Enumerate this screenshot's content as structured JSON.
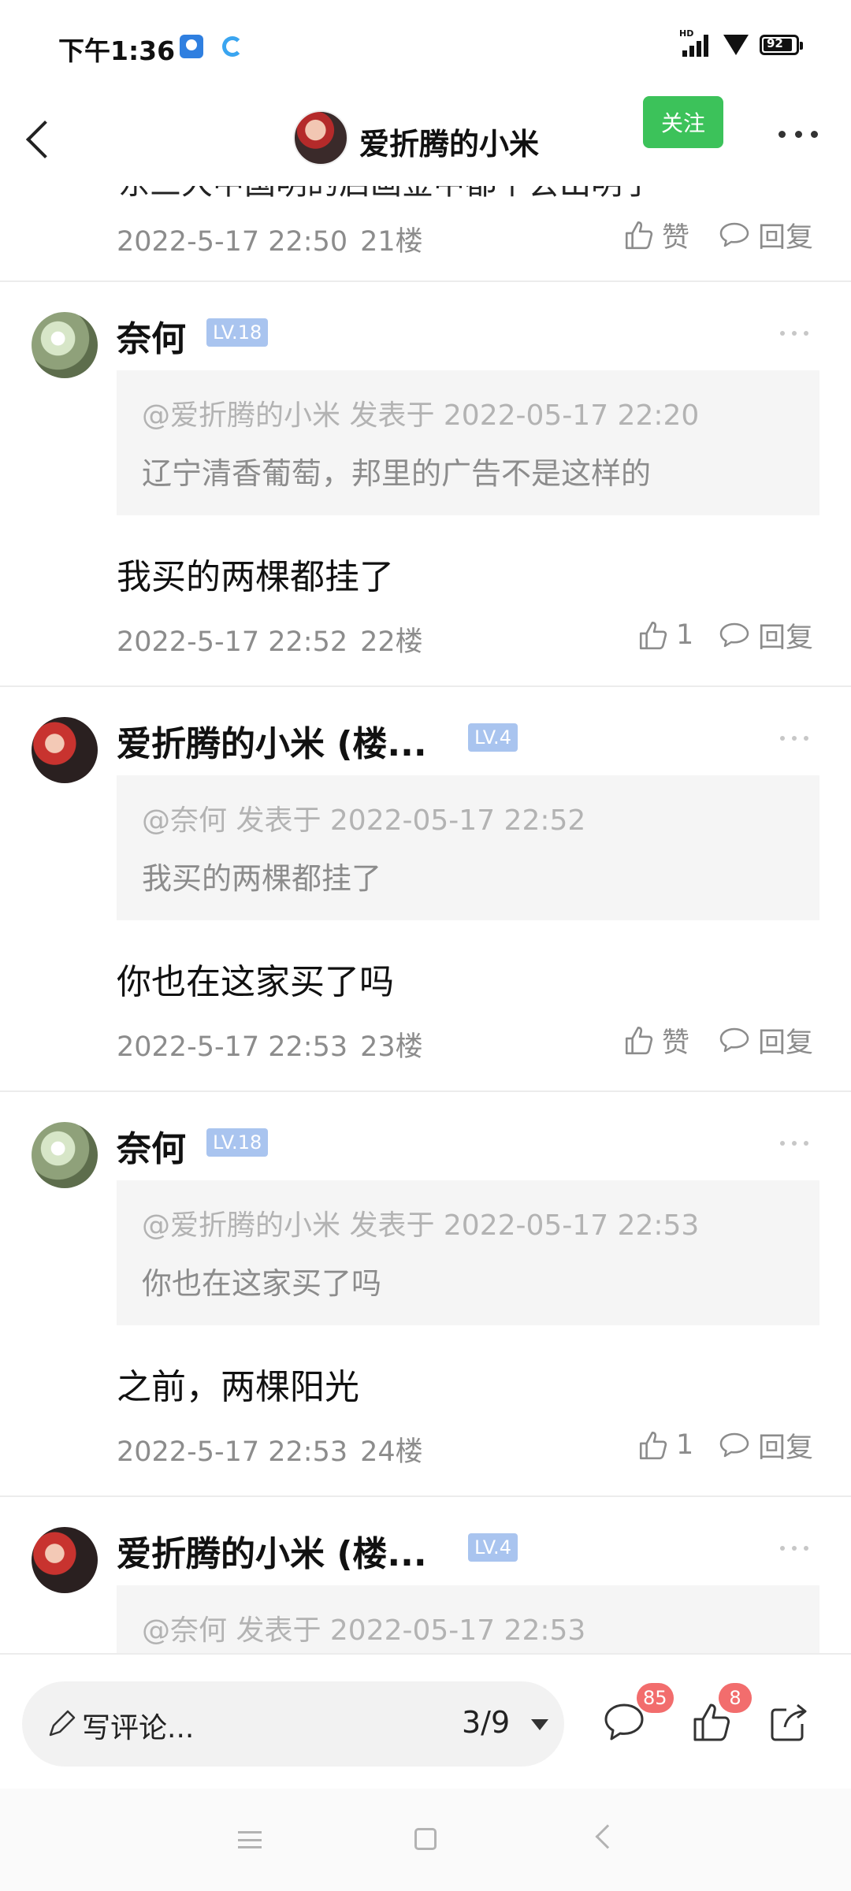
{
  "status_bar": {
    "time": "下午1:36",
    "network": "HD",
    "battery": "92"
  },
  "nav": {
    "title": "爱折腾的小米",
    "follow_label": "关注"
  },
  "post_top": {
    "cutoff_text": "东三大中国明的启画金中都个会出明了",
    "time": "2022-5-17 22:50",
    "floor": "21楼",
    "like_label": "赞",
    "reply_label": "回复"
  },
  "comments": [
    {
      "name": "奈何",
      "level": "LV.18",
      "quote_head": "@爱折腾的小米 发表于 2022-05-17 22:20",
      "quote_body": "辽宁清香葡萄，邦里的广告不是这样的",
      "text": "我买的两棵都挂了",
      "time": "2022-5-17 22:52",
      "floor": "22楼",
      "like_label": "1",
      "reply_label": "回复"
    },
    {
      "name": "爱折腾的小米 (楼...",
      "level": "LV.4",
      "quote_head": "@奈何 发表于 2022-05-17 22:52",
      "quote_body": "我买的两棵都挂了",
      "text": "你也在这家买了吗",
      "time": "2022-5-17 22:53",
      "floor": "23楼",
      "like_label": "赞",
      "reply_label": "回复"
    },
    {
      "name": "奈何",
      "level": "LV.18",
      "quote_head": "@爱折腾的小米 发表于 2022-05-17 22:53",
      "quote_body": "你也在这家买了吗",
      "text": "之前，两棵阳光",
      "time": "2022-5-17 22:53",
      "floor": "24楼",
      "like_label": "1",
      "reply_label": "回复"
    },
    {
      "name": "爱折腾的小米 (楼...",
      "level": "LV.4",
      "quote_head": "@奈何 发表于 2022-05-17 22:53"
    }
  ],
  "bottom_bar": {
    "compose_placeholder": "写评论...",
    "page_indicator": "3/9",
    "comment_count": "85",
    "like_count": "8"
  }
}
